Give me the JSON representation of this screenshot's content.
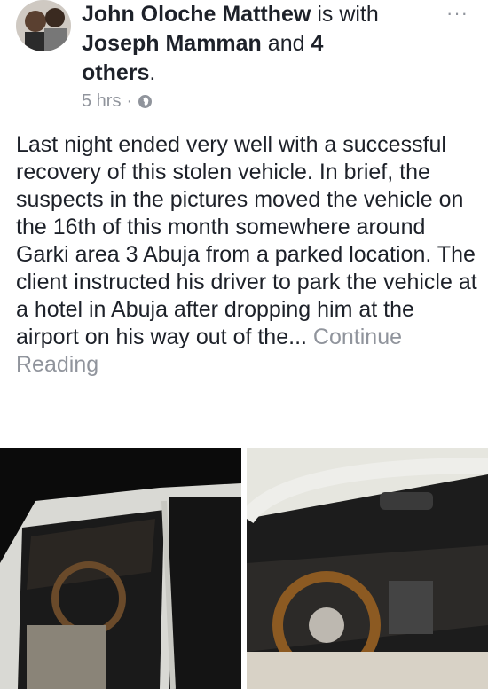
{
  "post": {
    "author": "John Oloche Matthew",
    "with_text": "is with",
    "tagged_person": "Joseph Mamman",
    "and_text": "and",
    "others_count": "4",
    "others_label": "others",
    "period": ".",
    "timestamp": "5 hrs",
    "separator": "·",
    "privacy_icon": "globe-icon",
    "more_icon": "more-options-icon",
    "more_glyph": "···",
    "body": "Last night ended very well with a successful recovery of this stolen vehicle. In brief, the suspects in the pictures moved the vehicle on the 16th of this month somewhere around Garki area 3 Abuja from a parked location. The client instructed his driver to park the vehicle at a hotel in Abuja after dropping him at the airport on his way out of the...",
    "continue_label": "Continue Reading"
  },
  "colors": {
    "text": "#1d2129",
    "muted": "#90949c"
  }
}
